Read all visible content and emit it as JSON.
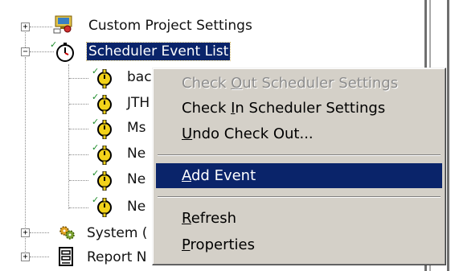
{
  "tree": {
    "nodes": [
      {
        "key": "custom",
        "label": "Custom Project Settings",
        "expander": "+",
        "icon": "custom-settings-icon"
      },
      {
        "key": "scheduler",
        "label": "Scheduler Event List",
        "expander": "−",
        "icon": "stopwatch-icon",
        "selected": true
      },
      {
        "key": "child1",
        "label": "bac",
        "icon": "event-clock-icon",
        "checked": true
      },
      {
        "key": "child2",
        "label": "JTH",
        "icon": "event-clock-icon",
        "checked": true
      },
      {
        "key": "child3",
        "label": "Ms",
        "icon": "event-clock-icon",
        "checked": true
      },
      {
        "key": "child4",
        "label": "Ne",
        "icon": "event-clock-icon",
        "checked": true
      },
      {
        "key": "child5",
        "label": "Ne",
        "icon": "event-clock-icon",
        "checked": true
      },
      {
        "key": "child6",
        "label": "Ne",
        "icon": "event-clock-icon",
        "checked": true
      },
      {
        "key": "system",
        "label": "System (",
        "expander": "+",
        "icon": "gear-cluster-icon"
      },
      {
        "key": "report",
        "label": "Report N",
        "expander": "+",
        "icon": "report-icon"
      }
    ]
  },
  "context_menu": {
    "items": [
      {
        "pre": "Check ",
        "u": "O",
        "post": "ut Scheduler Settings",
        "state": "disabled"
      },
      {
        "pre": "Check ",
        "u": "I",
        "post": "n Scheduler Settings",
        "state": "normal"
      },
      {
        "pre": "",
        "u": "U",
        "post": "ndo Check Out...",
        "state": "normal"
      },
      {
        "pre": "",
        "u": "A",
        "post": "dd Event",
        "state": "highlighted"
      },
      {
        "pre": "",
        "u": "R",
        "post": "efresh",
        "state": "normal"
      },
      {
        "pre": "",
        "u": "P",
        "post": "roperties",
        "state": "normal"
      }
    ]
  },
  "colors": {
    "selection": "#0a246a",
    "menu_face": "#d4d0c8",
    "disabled_text": "#8c8c8c",
    "check_green": "#1c8c2a"
  }
}
